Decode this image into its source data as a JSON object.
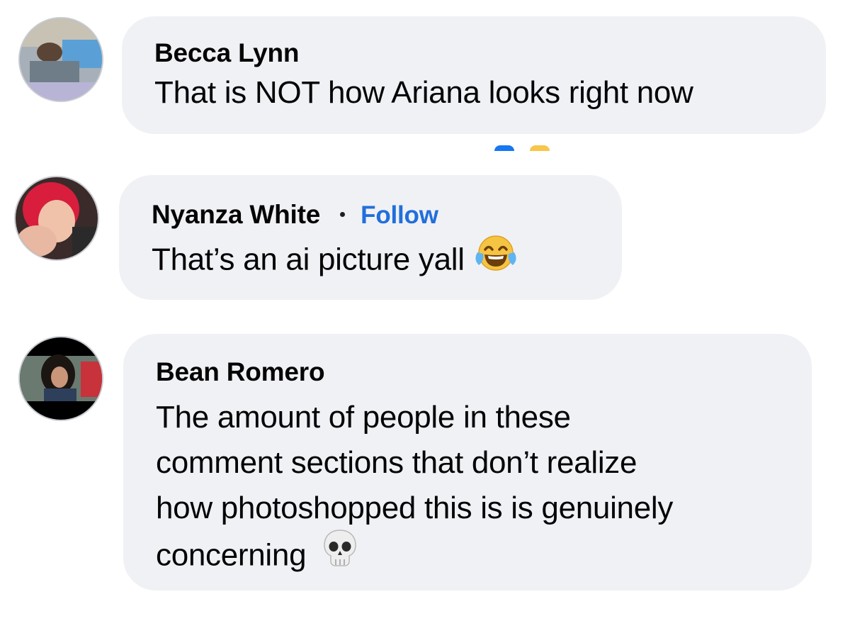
{
  "comments": [
    {
      "author": "Becca Lynn",
      "text": "That is NOT how Ariana looks right now"
    },
    {
      "author": "Nyanza White",
      "follow_label": "Follow",
      "text": "That’s an ai picture yall",
      "emoji_icon": "face-with-tears-of-joy-icon"
    },
    {
      "author": "Bean Romero",
      "text_lines": [
        "The amount of people in these",
        "comment sections that don’t realize",
        "how photoshopped this is is genuinely",
        "concerning"
      ],
      "emoji_icon": "skull-icon"
    }
  ],
  "colors": {
    "bubble": "#f0f1f5",
    "follow_link": "#216fdb",
    "text": "#050505"
  }
}
